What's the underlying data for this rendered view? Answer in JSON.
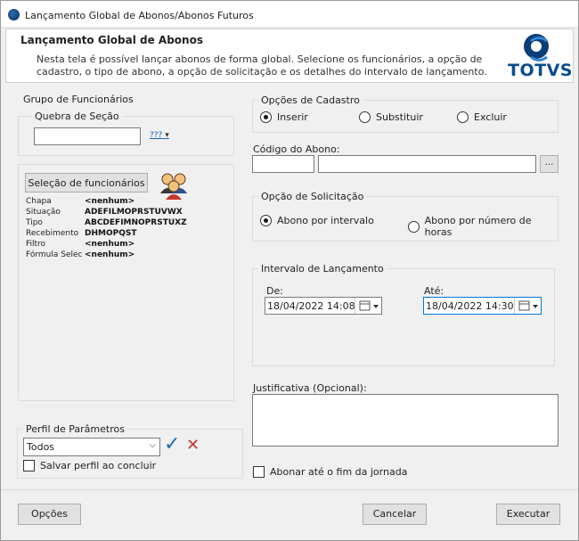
{
  "window": {
    "title": "Lançamento Global de Abonos/Abonos Futuros"
  },
  "header": {
    "title": "Lançamento Global de Abonos",
    "description": "Nesta tela é possível lançar abonos de forma global. Selecione os funcionários, a opção de cadastro, o tipo de abono, a opção de solicitação e os detalhes do intervalo de lançamento.",
    "logo_text": "TOTVS"
  },
  "grupo": {
    "legend": "Grupo de Funcionários",
    "quebra_legend": "Quebra de Seção",
    "quebra_value": "",
    "quebra_btn": "???",
    "selecao_btn": "Seleção de funcionários",
    "rows": [
      {
        "label": "Chapa",
        "value": "<nenhum>"
      },
      {
        "label": "Situação",
        "value": "ADEFILMOPRSTUVWX"
      },
      {
        "label": "Tipo",
        "value": "ABCDEFIMNOPRSTUXZ"
      },
      {
        "label": "Recebimento",
        "value": "DHMOPQST"
      },
      {
        "label": "Filtro",
        "value": "<nenhum>"
      },
      {
        "label": "Fórmula Selec",
        "value": "<nenhum>"
      }
    ]
  },
  "perfil": {
    "legend": "Perfil de Parâmetros",
    "selected": "Todos",
    "salvar_label": "Salvar perfil ao concluir"
  },
  "cadastro": {
    "legend": "Opções de Cadastro",
    "options": [
      "Inserir",
      "Substituir",
      "Excluir"
    ],
    "selected": "Inserir"
  },
  "codigo": {
    "label": "Código do Abono:",
    "code": "",
    "description": "",
    "lookup": "..."
  },
  "solicitacao": {
    "legend": "Opção de Solicitação",
    "options": [
      "Abono por intervalo",
      "Abono por número de horas"
    ],
    "selected": "Abono por intervalo"
  },
  "intervalo": {
    "legend": "Intervalo de Lançamento",
    "de_label": "De:",
    "de_value": "18/04/2022 14:08",
    "ate_label": "Até:",
    "ate_value": "18/04/2022 14:30"
  },
  "justificativa": {
    "label": "Justificativa (Opcional):",
    "value": ""
  },
  "abonar_label": "Abonar até o fim da jornada",
  "buttons": {
    "opcoes": "Opções",
    "cancelar": "Cancelar",
    "executar": "Executar"
  },
  "colors": {
    "accent": "#0b4c8f",
    "check": "#1f6fb2",
    "cross": "#c0392b",
    "focus": "#0078d7"
  },
  "icons": {
    "users": "users-icon",
    "calendar": "calendar-icon",
    "confirm": "check-icon",
    "cancel": "x-icon"
  }
}
